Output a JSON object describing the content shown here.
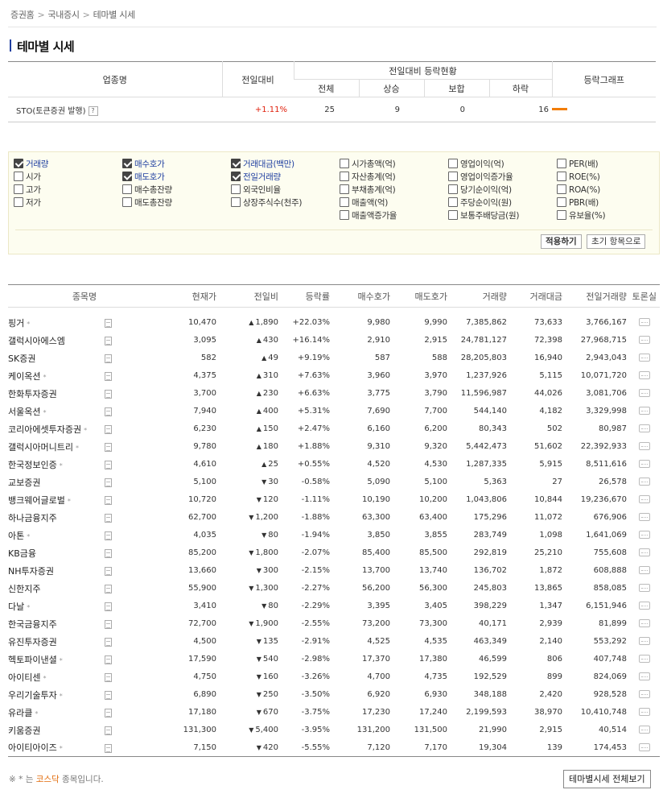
{
  "breadcrumb": [
    "증권홈",
    "국내증시",
    "테마별 시세"
  ],
  "page_title": "테마별 시세",
  "summary": {
    "headers": {
      "industry": "업종명",
      "prev_diff": "전일대비",
      "status_group": "전일대비 등락현황",
      "total": "전체",
      "up": "상승",
      "flat": "보합",
      "down": "하락",
      "graph": "등락그래프"
    },
    "row": {
      "name": "STO(토큰증권 발행)",
      "help_icon": "?",
      "change": "+1.11%",
      "total": "25",
      "up": "9",
      "flat": "0",
      "down": "16",
      "graph_color": "#f27d06"
    }
  },
  "options": {
    "columns": [
      [
        {
          "label": "거래량",
          "checked": true
        },
        {
          "label": "시가",
          "checked": false
        },
        {
          "label": "고가",
          "checked": false
        },
        {
          "label": "저가",
          "checked": false
        }
      ],
      [
        {
          "label": "매수호가",
          "checked": true
        },
        {
          "label": "매도호가",
          "checked": true
        },
        {
          "label": "매수총잔량",
          "checked": false
        },
        {
          "label": "매도총잔량",
          "checked": false
        }
      ],
      [
        {
          "label": "거래대금(백만)",
          "checked": true
        },
        {
          "label": "전일거래량",
          "checked": true
        },
        {
          "label": "외국인비율",
          "checked": false
        },
        {
          "label": "상장주식수(천주)",
          "checked": false
        }
      ],
      [
        {
          "label": "시가총액(억)",
          "checked": false
        },
        {
          "label": "자산총계(억)",
          "checked": false
        },
        {
          "label": "부채총계(억)",
          "checked": false
        },
        {
          "label": "매출액(억)",
          "checked": false
        },
        {
          "label": "매출액증가율",
          "checked": false
        }
      ],
      [
        {
          "label": "영업이익(억)",
          "checked": false
        },
        {
          "label": "영업이익증가율",
          "checked": false
        },
        {
          "label": "당기순이익(억)",
          "checked": false
        },
        {
          "label": "주당순이익(원)",
          "checked": false
        },
        {
          "label": "보통주배당금(원)",
          "checked": false
        }
      ],
      [
        {
          "label": "PER(배)",
          "checked": false
        },
        {
          "label": "ROE(%)",
          "checked": false
        },
        {
          "label": "ROA(%)",
          "checked": false
        },
        {
          "label": "PBR(배)",
          "checked": false
        },
        {
          "label": "유보율(%)",
          "checked": false
        }
      ]
    ],
    "apply_label": "적용하기",
    "reset_label": "초기 항목으로"
  },
  "stock_table": {
    "headers": [
      "종목명",
      "현재가",
      "전일비",
      "등락률",
      "매수호가",
      "매도호가",
      "거래량",
      "거래대금",
      "전일거래량",
      "토론실"
    ],
    "rows": [
      {
        "name": "핑거",
        "kosdaq": true,
        "price": "10,470",
        "dir": "up",
        "diff": "1,890",
        "rate": "+22.03%",
        "bid": "9,980",
        "ask": "9,990",
        "vol": "7,385,862",
        "amt": "73,633",
        "prev_vol": "3,766,167"
      },
      {
        "name": "갤럭시아에스엠",
        "kosdaq": false,
        "price": "3,095",
        "dir": "up",
        "diff": "430",
        "rate": "+16.14%",
        "bid": "2,910",
        "ask": "2,915",
        "vol": "24,781,127",
        "amt": "72,398",
        "prev_vol": "27,968,715"
      },
      {
        "name": "SK증권",
        "kosdaq": false,
        "price": "582",
        "dir": "up",
        "diff": "49",
        "rate": "+9.19%",
        "bid": "587",
        "ask": "588",
        "vol": "28,205,803",
        "amt": "16,940",
        "prev_vol": "2,943,043"
      },
      {
        "name": "케이옥션",
        "kosdaq": true,
        "price": "4,375",
        "dir": "up",
        "diff": "310",
        "rate": "+7.63%",
        "bid": "3,960",
        "ask": "3,970",
        "vol": "1,237,926",
        "amt": "5,115",
        "prev_vol": "10,071,720"
      },
      {
        "name": "한화투자증권",
        "kosdaq": false,
        "price": "3,700",
        "dir": "up",
        "diff": "230",
        "rate": "+6.63%",
        "bid": "3,775",
        "ask": "3,790",
        "vol": "11,596,987",
        "amt": "44,026",
        "prev_vol": "3,081,706"
      },
      {
        "name": "서울옥션",
        "kosdaq": true,
        "price": "7,940",
        "dir": "up",
        "diff": "400",
        "rate": "+5.31%",
        "bid": "7,690",
        "ask": "7,700",
        "vol": "544,140",
        "amt": "4,182",
        "prev_vol": "3,329,998"
      },
      {
        "name": "코리아에셋투자증권",
        "kosdaq": true,
        "price": "6,230",
        "dir": "up",
        "diff": "150",
        "rate": "+2.47%",
        "bid": "6,160",
        "ask": "6,200",
        "vol": "80,343",
        "amt": "502",
        "prev_vol": "80,987"
      },
      {
        "name": "갤럭시아머니트리",
        "kosdaq": true,
        "price": "9,780",
        "dir": "up",
        "diff": "180",
        "rate": "+1.88%",
        "bid": "9,310",
        "ask": "9,320",
        "vol": "5,442,473",
        "amt": "51,602",
        "prev_vol": "22,392,933"
      },
      {
        "name": "한국정보인증",
        "kosdaq": true,
        "price": "4,610",
        "dir": "up",
        "diff": "25",
        "rate": "+0.55%",
        "bid": "4,520",
        "ask": "4,530",
        "vol": "1,287,335",
        "amt": "5,915",
        "prev_vol": "8,511,616"
      },
      {
        "name": "교보증권",
        "kosdaq": false,
        "price": "5,100",
        "dir": "down",
        "diff": "30",
        "rate": "-0.58%",
        "bid": "5,090",
        "ask": "5,100",
        "vol": "5,363",
        "amt": "27",
        "prev_vol": "26,578"
      },
      {
        "name": "뱅크웨어글로벌",
        "kosdaq": true,
        "price": "10,720",
        "dir": "down",
        "diff": "120",
        "rate": "-1.11%",
        "bid": "10,190",
        "ask": "10,200",
        "vol": "1,043,806",
        "amt": "10,844",
        "prev_vol": "19,236,670"
      },
      {
        "name": "하나금융지주",
        "kosdaq": false,
        "price": "62,700",
        "dir": "down",
        "diff": "1,200",
        "rate": "-1.88%",
        "bid": "63,300",
        "ask": "63,400",
        "vol": "175,296",
        "amt": "11,072",
        "prev_vol": "676,906"
      },
      {
        "name": "아톤",
        "kosdaq": true,
        "price": "4,035",
        "dir": "down",
        "diff": "80",
        "rate": "-1.94%",
        "bid": "3,850",
        "ask": "3,855",
        "vol": "283,749",
        "amt": "1,098",
        "prev_vol": "1,641,069"
      },
      {
        "name": "KB금융",
        "kosdaq": false,
        "price": "85,200",
        "dir": "down",
        "diff": "1,800",
        "rate": "-2.07%",
        "bid": "85,400",
        "ask": "85,500",
        "vol": "292,819",
        "amt": "25,210",
        "prev_vol": "755,608"
      },
      {
        "name": "NH투자증권",
        "kosdaq": false,
        "price": "13,660",
        "dir": "down",
        "diff": "300",
        "rate": "-2.15%",
        "bid": "13,700",
        "ask": "13,740",
        "vol": "136,702",
        "amt": "1,872",
        "prev_vol": "608,888"
      },
      {
        "name": "신한지주",
        "kosdaq": false,
        "price": "55,900",
        "dir": "down",
        "diff": "1,300",
        "rate": "-2.27%",
        "bid": "56,200",
        "ask": "56,300",
        "vol": "245,803",
        "amt": "13,865",
        "prev_vol": "858,085"
      },
      {
        "name": "다날",
        "kosdaq": true,
        "price": "3,410",
        "dir": "down",
        "diff": "80",
        "rate": "-2.29%",
        "bid": "3,395",
        "ask": "3,405",
        "vol": "398,229",
        "amt": "1,347",
        "prev_vol": "6,151,946"
      },
      {
        "name": "한국금융지주",
        "kosdaq": false,
        "price": "72,700",
        "dir": "down",
        "diff": "1,900",
        "rate": "-2.55%",
        "bid": "73,200",
        "ask": "73,300",
        "vol": "40,171",
        "amt": "2,939",
        "prev_vol": "81,899"
      },
      {
        "name": "유진투자증권",
        "kosdaq": false,
        "price": "4,500",
        "dir": "down",
        "diff": "135",
        "rate": "-2.91%",
        "bid": "4,525",
        "ask": "4,535",
        "vol": "463,349",
        "amt": "2,140",
        "prev_vol": "553,292"
      },
      {
        "name": "헥토파이낸셜",
        "kosdaq": true,
        "price": "17,590",
        "dir": "down",
        "diff": "540",
        "rate": "-2.98%",
        "bid": "17,370",
        "ask": "17,380",
        "vol": "46,599",
        "amt": "806",
        "prev_vol": "407,748"
      },
      {
        "name": "아이티센",
        "kosdaq": true,
        "price": "4,750",
        "dir": "down",
        "diff": "160",
        "rate": "-3.26%",
        "bid": "4,700",
        "ask": "4,735",
        "vol": "192,529",
        "amt": "899",
        "prev_vol": "824,069"
      },
      {
        "name": "우리기술투자",
        "kosdaq": true,
        "price": "6,890",
        "dir": "down",
        "diff": "250",
        "rate": "-3.50%",
        "bid": "6,920",
        "ask": "6,930",
        "vol": "348,188",
        "amt": "2,420",
        "prev_vol": "928,528"
      },
      {
        "name": "유라클",
        "kosdaq": true,
        "price": "17,180",
        "dir": "down",
        "diff": "670",
        "rate": "-3.75%",
        "bid": "17,230",
        "ask": "17,240",
        "vol": "2,199,593",
        "amt": "38,970",
        "prev_vol": "10,410,748"
      },
      {
        "name": "키움증권",
        "kosdaq": false,
        "price": "131,300",
        "dir": "down",
        "diff": "5,400",
        "rate": "-3.95%",
        "bid": "131,200",
        "ask": "131,500",
        "vol": "21,990",
        "amt": "2,915",
        "prev_vol": "40,514"
      },
      {
        "name": "아이티아이즈",
        "kosdaq": true,
        "price": "7,150",
        "dir": "down",
        "diff": "420",
        "rate": "-5.55%",
        "bid": "7,120",
        "ask": "7,170",
        "vol": "19,304",
        "amt": "139",
        "prev_vol": "174,453"
      }
    ]
  },
  "footnote": {
    "prefix": "※ * 는 ",
    "kosdaq": "코스닥",
    "suffix": " 종목입니다."
  },
  "view_all_label": "테마별시세 전체보기",
  "colors": {
    "up": "#e0210d",
    "down": "#1a4fc4",
    "accent": "#1f3fa0",
    "graph": "#f27d06",
    "kosdaq": "#e26b0a"
  }
}
